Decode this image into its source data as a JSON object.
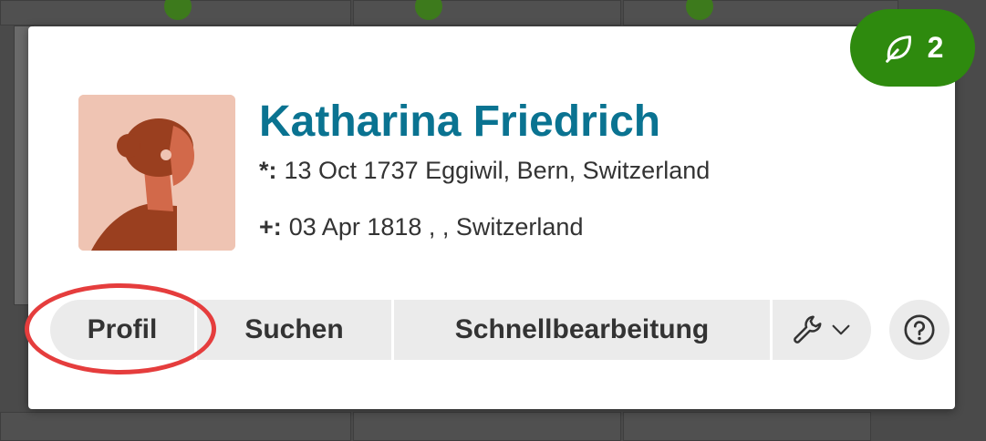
{
  "person": {
    "name": "Katharina Friedrich",
    "birth_symbol": "*:",
    "birth": "13 Oct 1737 Eggiwil, Bern, Switzerland",
    "death_symbol": "+:",
    "death": "03 Apr 1818 , , Switzerland"
  },
  "leaf_badge": {
    "count": "2",
    "icon": "leaf-icon"
  },
  "actions": {
    "profil": "Profil",
    "suchen": "Suchen",
    "schnellbearbeitung": "Schnellbearbeitung",
    "tools_icon": "wrench-icon"
  },
  "help": {
    "icon": "help-icon"
  },
  "colors": {
    "name": "#0a7391",
    "badge": "#2e8a0e",
    "highlight": "#e53d3d",
    "button_bg": "#ebebeb"
  }
}
